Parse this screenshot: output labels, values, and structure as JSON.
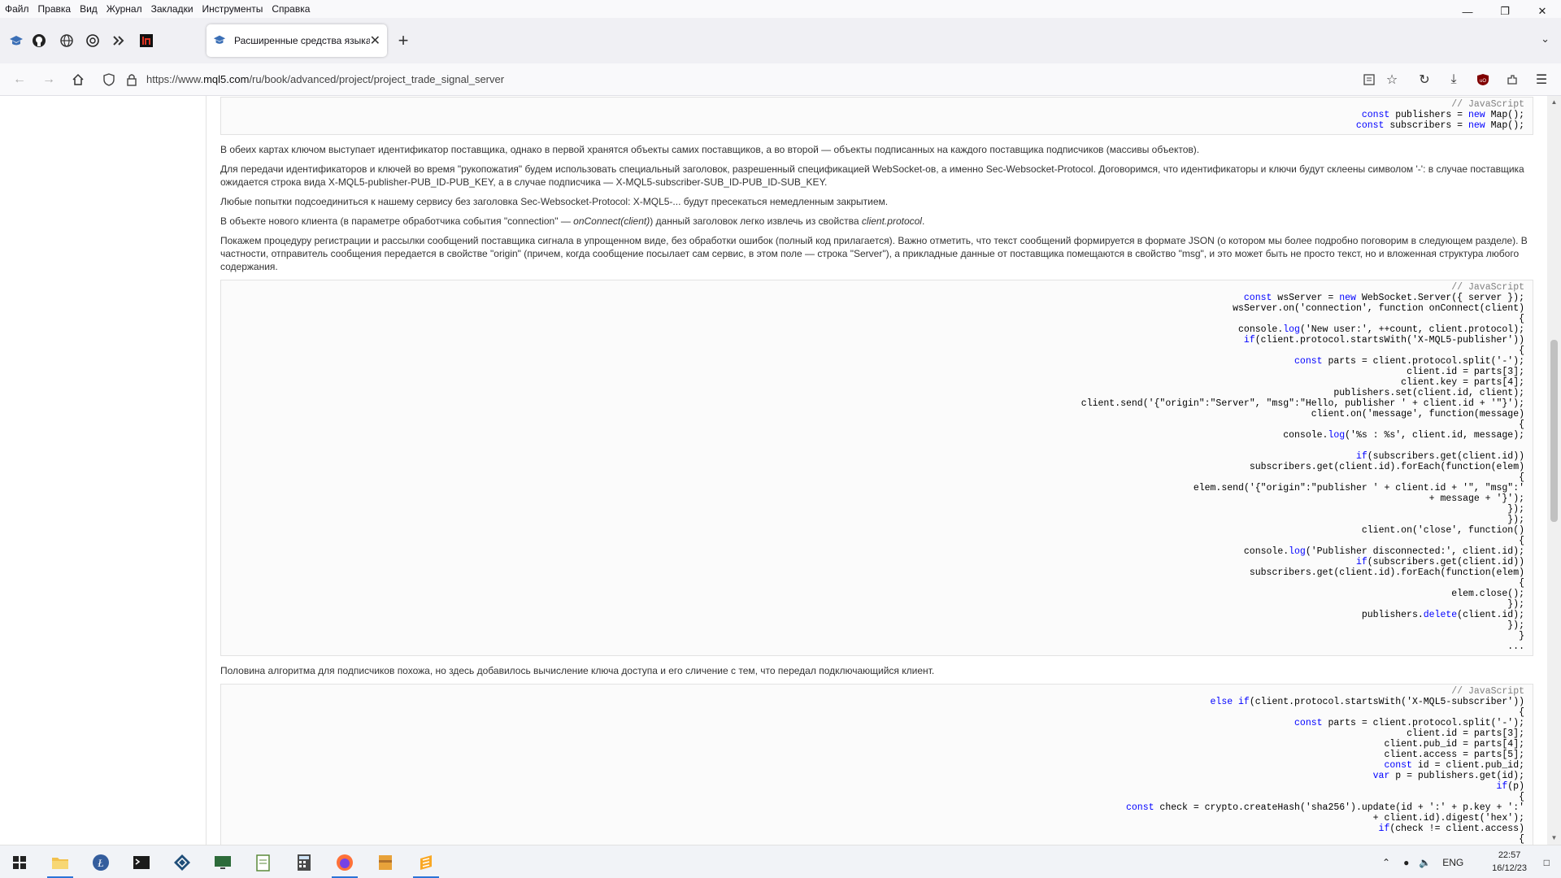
{
  "menu": [
    "Файл",
    "Правка",
    "Вид",
    "Журнал",
    "Закладки",
    "Инструменты",
    "Справка"
  ],
  "window_controls": [
    "minimize",
    "restore",
    "close"
  ],
  "pinned_tabs": [
    "mql5-icon",
    "github-icon",
    "globe-icon",
    "openai-icon",
    "app-icon",
    "in-icon"
  ],
  "active_tab": {
    "title": "Расширенные средства языка",
    "close": "✕"
  },
  "new_tab": "+",
  "url": {
    "prefix": "https://www.",
    "domain": "mql5.com",
    "path": "/ru/book/advanced/project/project_trade_signal_server"
  },
  "content": {
    "code1": [
      {
        "t": "// JavaScript",
        "c": "cm"
      },
      {
        "t": "const publishers = new Map();"
      },
      {
        "t": "const subscribers = new Map();"
      }
    ],
    "p1": "В обеих картах ключом выступает идентификатор поставщика, однако в первой хранятся объекты самих поставщиков, а во второй — объекты подписанных на каждого поставщика подписчиков (массивы объектов).",
    "p2": "Для передачи идентификаторов и ключей во время \"рукопожатия\" будем использовать специальный заголовок, разрешенный спецификацией WebSocket-ов, а именно Sec-Websocket-Protocol. Договоримся, что идентификаторы и ключи будут склеены символом '-': в случае поставщика ожидается строка вида X-MQL5-publisher-PUB_ID-PUB_KEY, а в случае подписчика — X-MQL5-subscriber-SUB_ID-PUB_ID-SUB_KEY.",
    "p3": "Любые попытки подсоединиться к нашему сервису без заголовка Sec-Websocket-Protocol: X-MQL5-... будут пресекаться немедленным закрытием.",
    "p4_a": "В объекте нового клиента (в параметре обработчика события \"connection\" — ",
    "p4_i1": "onConnect(client)",
    "p4_b": ") данный заголовок легко извлечь из свойства ",
    "p4_i2": "client.protocol",
    "p4_c": ".",
    "p5": "Покажем процедуру регистрации и рассылки сообщений поставщика сигнала в упрощенном виде, без обработки ошибок (полный код прилагается). Важно отметить, что текст сообщений формируется в формате JSON (о котором мы более подробно поговорим в следующем разделе). В частности, отправитель сообщения передается в свойстве \"origin\" (причем, когда сообщение посылает сам сервис, в этом поле — строка \"Server\"), а прикладные данные от поставщика помещаются в свойство \"msg\", и это может быть не просто текст, но и вложенная структура любого содержания.",
    "code2": [
      {
        "t": "// JavaScript",
        "c": "cm"
      },
      {
        "t": "const wsServer = new WebSocket.Server({ server });"
      },
      {
        "t": "wsServer.on('connection', function onConnect(client)"
      },
      {
        "t": "{"
      },
      {
        "t": "console.log('New user:', ++count, client.protocol);"
      },
      {
        "t": "if(client.protocol.startsWith('X-MQL5-publisher'))"
      },
      {
        "t": "{"
      },
      {
        "t": "const parts = client.protocol.split('-');"
      },
      {
        "t": "client.id = parts[3];"
      },
      {
        "t": "client.key = parts[4];"
      },
      {
        "t": "publishers.set(client.id, client);"
      },
      {
        "t": "client.send('{\"origin\":\"Server\", \"msg\":\"Hello, publisher ' + client.id + '\"}');"
      },
      {
        "t": "client.on('message', function(message)"
      },
      {
        "t": "{"
      },
      {
        "t": "console.log('%s : %s', client.id, message);"
      },
      {
        "t": ""
      },
      {
        "t": "if(subscribers.get(client.id))"
      },
      {
        "t": "subscribers.get(client.id).forEach(function(elem)"
      },
      {
        "t": "{"
      },
      {
        "t": "elem.send('{\"origin\":\"publisher ' + client.id + '\", \"msg\":'"
      },
      {
        "t": "+ message + '}');"
      },
      {
        "t": "});"
      },
      {
        "t": "});"
      },
      {
        "t": "client.on('close', function()"
      },
      {
        "t": "{"
      },
      {
        "t": "console.log('Publisher disconnected:', client.id);"
      },
      {
        "t": "if(subscribers.get(client.id))"
      },
      {
        "t": "subscribers.get(client.id).forEach(function(elem)"
      },
      {
        "t": "{"
      },
      {
        "t": "elem.close();"
      },
      {
        "t": "});"
      },
      {
        "t": "publishers.delete(client.id);"
      },
      {
        "t": "});"
      },
      {
        "t": "}"
      },
      {
        "t": "..."
      }
    ],
    "p6": "Половина алгоритма для подписчиков похожа, но здесь добавилось вычисление ключа доступа и его сличение с тем, что передал подключающийся клиент.",
    "code3": [
      {
        "t": "// JavaScript",
        "c": "cm"
      },
      {
        "t": "else if(client.protocol.startsWith('X-MQL5-subscriber'))"
      },
      {
        "t": "{"
      },
      {
        "t": "const parts = client.protocol.split('-');"
      },
      {
        "t": "client.id = parts[3];"
      },
      {
        "t": "client.pub_id = parts[4];"
      },
      {
        "t": "client.access = parts[5];"
      },
      {
        "t": "const id = client.pub_id;"
      },
      {
        "t": "var p = publishers.get(id);"
      },
      {
        "t": "if(p)"
      },
      {
        "t": "{"
      },
      {
        "t": "const check = crypto.createHash('sha256').update(id + ':' + p.key + ':'"
      },
      {
        "t": "+ client.id).digest('hex');"
      },
      {
        "t": "if(check != client.access)"
      },
      {
        "t": "{"
      }
    ]
  },
  "taskbar": {
    "apps": [
      "windows-start-icon",
      "file-explorer-icon",
      "litecoin-icon",
      "terminal-icon",
      "app-diamond-icon",
      "monitor-icon",
      "notepad-icon",
      "calculator-icon",
      "firefox-icon",
      "archive-icon",
      "sublime-icon"
    ],
    "lang": "ENG",
    "time": "22:57",
    "date": "16/12/23"
  }
}
